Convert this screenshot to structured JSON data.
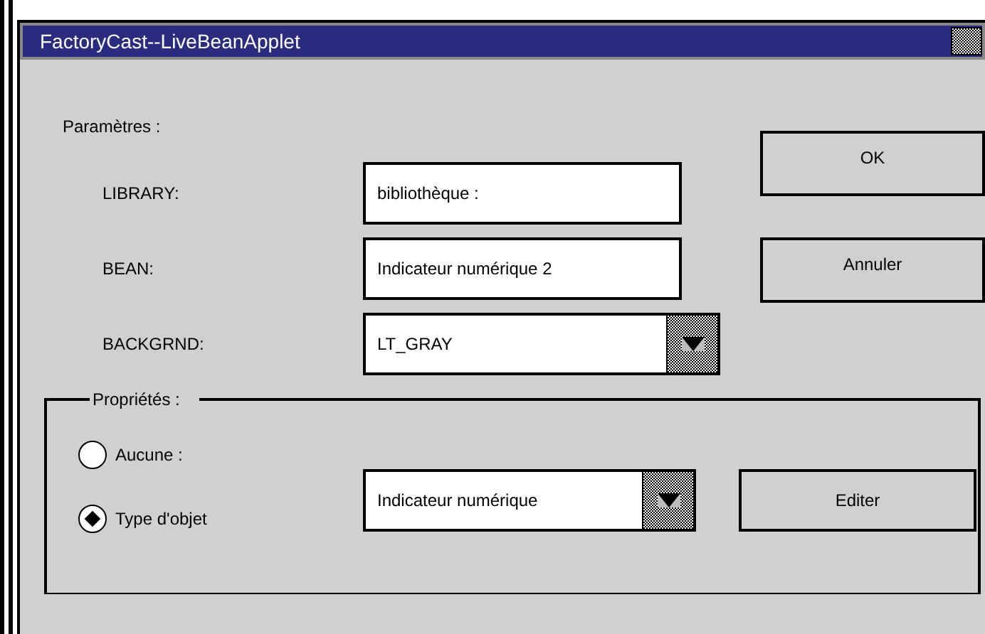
{
  "window": {
    "title": "FactoryCast--LiveBeanApplet"
  },
  "parameters": {
    "label": "Paramètres :",
    "fields": [
      {
        "kind": "text",
        "label": "LIBRARY:",
        "value": "bibliothèque :"
      },
      {
        "kind": "text",
        "label": "BEAN:",
        "value": "Indicateur numérique 2"
      },
      {
        "kind": "dropdown",
        "label": "BACKGRND:",
        "value": "LT_GRAY"
      }
    ]
  },
  "buttons": [
    "OK",
    "Annuler"
  ],
  "properties": {
    "label": "Propriétés :",
    "options": [
      {
        "label": "Aucune :",
        "selected": false
      },
      {
        "label": "Type d'objet",
        "selected": true
      }
    ],
    "type_dropdown": {
      "value": "Indicateur numérique"
    },
    "edit_button": "Editer"
  }
}
